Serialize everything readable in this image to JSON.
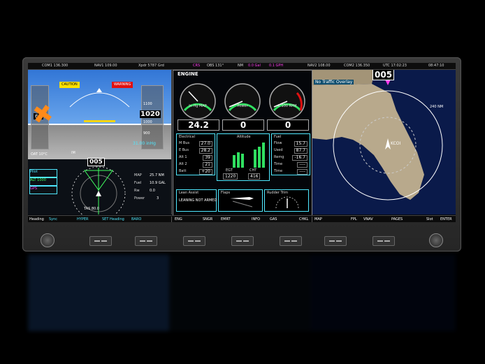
{
  "topbar": {
    "com1": "COM1  136.300",
    "nav1": "NAV1  109.00",
    "xpdr": "Xpdr  5787  Grd",
    "crs": "CRS",
    "obs": "OBS  131°",
    "nm": "NM",
    "d7": "0.7",
    "gal": "0.0 Gal",
    "gph": "0.1 GPH",
    "nav2": "NAV2  108.00",
    "com2": "COM2  136.350",
    "utc": "UTC  17:02:23",
    "time": "08:47:10"
  },
  "pfd": {
    "caution": "CAUTION",
    "warning": "WARNING",
    "speed_kt": "60",
    "alt1": "1100",
    "alt2": "1020",
    "alt3": "1000",
    "alt4": "900",
    "baro": "31.00 inHg",
    "oat": "OAT  10°C",
    "heading": "005",
    "tas": "TAS   80.0",
    "ias": "IAS",
    "gs": "GS",
    "im": "IM",
    "left_box1": "Pilot",
    "left_box2": "ALT 1000",
    "left_box3": "GPS",
    "map_label": "MAP",
    "map_val": "25.7 NM",
    "fuel_label": "Fuel",
    "fuel_val": "10.9 GAL",
    "rw_label": "Rw",
    "rw_val": "0.0",
    "power_label": "Power",
    "power_val": "3"
  },
  "engine": {
    "title": "ENGINE",
    "g1_label": "In Hg\nMAP",
    "g1_value": "24.2",
    "g2_label": "Power",
    "g2_value": "0",
    "g3_label": "X 100\nRPM",
    "g3_value": "0",
    "left_panel_title": "Electrical",
    "left_rows": [
      {
        "l": "M Bus",
        "v": "27.0"
      },
      {
        "l": "E Bus",
        "v": "28.2"
      },
      {
        "l": "Alt 1",
        "v": "39"
      },
      {
        "l": "Alt 2",
        "v": "21"
      },
      {
        "l": "Batt",
        "v": "+20"
      }
    ],
    "mid_panel_title": "Altitude",
    "egt_label": "EGT",
    "egt_val": "1220",
    "cht_label": "CHT",
    "cht_val": "416",
    "right_panel_title": "Fuel",
    "right_rows": [
      {
        "l": "Flow",
        "v": "15.7"
      },
      {
        "l": "Used",
        "v": "87.7"
      },
      {
        "l": "Remg",
        "v": "-16.7"
      },
      {
        "l": "Time",
        "v": "----"
      },
      {
        "l": "Time",
        "v": "----"
      }
    ],
    "bl_title": "Lean Assist",
    "bl_text": "LEANING NOT ARMED",
    "bm_title": "Flaps",
    "br_title": "Rudder Trim"
  },
  "map": {
    "heading": "005",
    "traffic": "No Traffic Overlay",
    "range": "240 NM",
    "ident": "KCOI"
  },
  "softkeys": {
    "heading": "Heading",
    "sync": "Sync",
    "hyper": "HYPER",
    "set": "SET Heading",
    "baro": "BARO",
    "eng": "ENG",
    "sngr": "SNGR",
    "eng2": "EMRT",
    "info": "INFO",
    "gas": "GAS",
    "chkl": "CHKL",
    "map": "MAP",
    "fpl": "FPL",
    "vnav": "VNAV",
    "pages": "PAGES",
    "enter": "Slot",
    "enter2": "ENTER"
  }
}
